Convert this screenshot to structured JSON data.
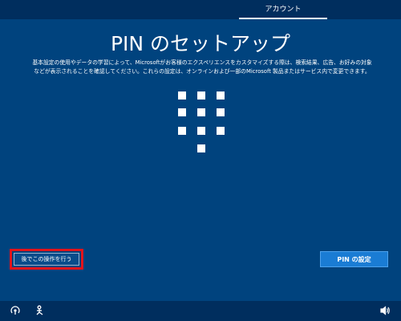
{
  "header": {
    "step_label": "アカウント"
  },
  "main": {
    "title": "PIN のセットアップ",
    "description_lines": [
      "基本設定の使用やデータの学習によって、Microsoftがお客様のエクスペリエンスをカスタマイズする際は、検索結果、広告、お好みの対象",
      "などが表示されることを確認してください。これらの設定は、オンラインおよび一部のMicrosoft 製品またはサービス内で変更できます。"
    ]
  },
  "buttons": {
    "later_label": "後でこの操作を行う",
    "set_pin_label": "PIN の設定"
  },
  "footer": {
    "icons": [
      "ease-of-access-icon",
      "accessibility-person-icon",
      "volume-icon"
    ]
  },
  "colors": {
    "background": "#00437e",
    "bars": "#002e5e",
    "primary_button": "#1a7cd4",
    "highlight": "#e1141b"
  }
}
